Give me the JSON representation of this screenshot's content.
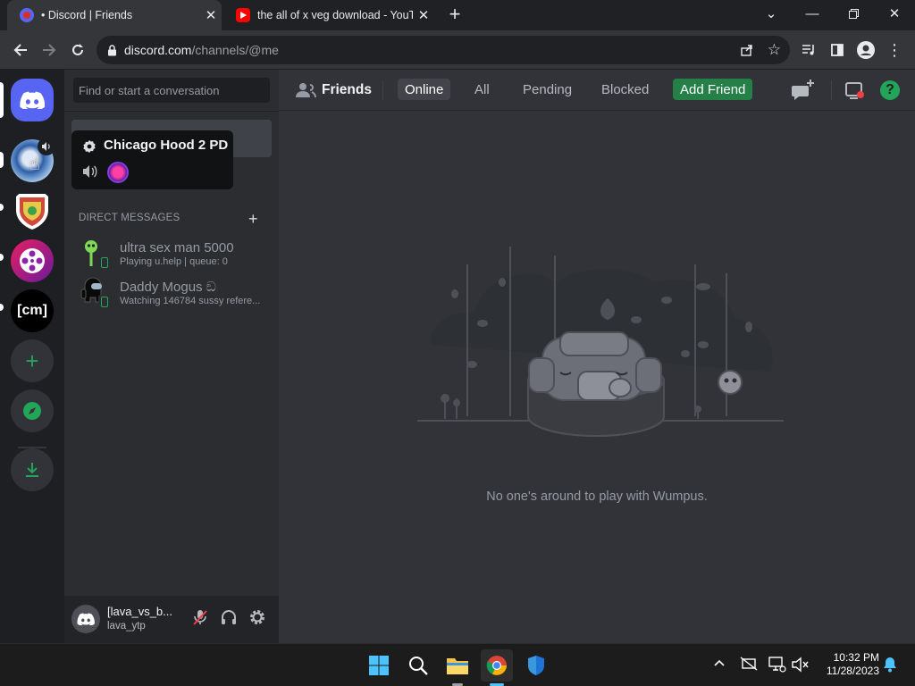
{
  "browser": {
    "tabs": [
      {
        "title": "• Discord | Friends",
        "active": true
      },
      {
        "title": "the all of x veg download - YouTube",
        "active": false
      }
    ],
    "url_host": "discord.com",
    "url_path": "/channels/@me"
  },
  "discord": {
    "search_placeholder": "Find or start a conversation",
    "servers": [
      {
        "name": "discord-home"
      },
      {
        "name": "chicago-hood"
      },
      {
        "name": "shield-server"
      },
      {
        "name": "film-server"
      },
      {
        "name": "cm-server",
        "label": "[cm]"
      }
    ],
    "tooltip": {
      "title": "Chicago Hood 2 PD"
    },
    "dm_section_label": "DIRECT MESSAGES",
    "dms": [
      {
        "name": "ultra sex man 5000",
        "status": "Playing u.help | queue: 0"
      },
      {
        "name": "Daddy Mogus ඞ",
        "status": "Watching 146784 sussy refere..."
      }
    ],
    "user": {
      "name": "[lava_vs_b...",
      "tag": "lava_ytp"
    },
    "header": {
      "title": "Friends",
      "tabs": [
        "Online",
        "All",
        "Pending",
        "Blocked"
      ],
      "add_friend": "Add Friend"
    },
    "empty_text": "No one's around to play with Wumpus."
  },
  "taskbar": {
    "time": "10:32 PM",
    "date": "11/28/2023"
  },
  "colors": {
    "blurple": "#5865f2",
    "green": "#248046",
    "discord_bg": "#313338"
  }
}
